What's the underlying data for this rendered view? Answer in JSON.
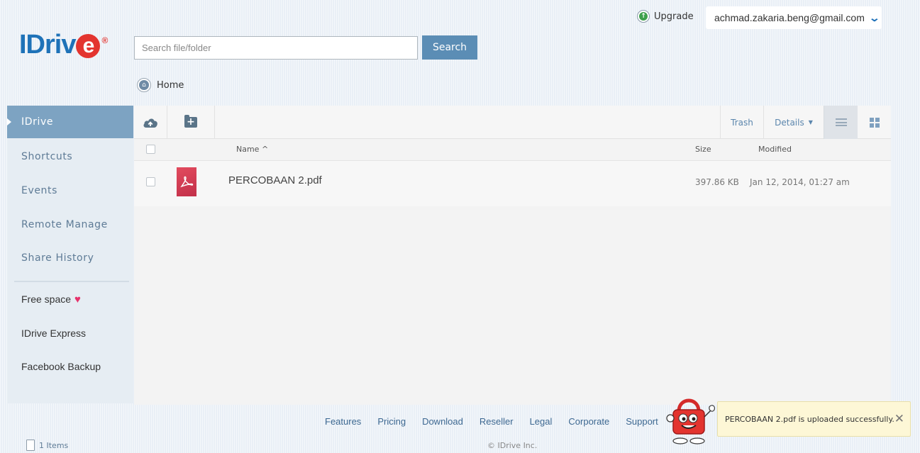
{
  "header": {
    "upgrade_label": "Upgrade",
    "account_email": "achmad.zakaria.beng@gmail.com"
  },
  "logo": {
    "text": "IDriv",
    "e_letter": "e",
    "reg": "®"
  },
  "search": {
    "placeholder": "Search file/folder",
    "value": "",
    "button_label": "Search"
  },
  "breadcrumb": {
    "home_label": "Home"
  },
  "sidebar": {
    "items": [
      {
        "label": "IDrive",
        "active": true
      },
      {
        "label": "Shortcuts"
      },
      {
        "label": "Events"
      },
      {
        "label": "Remote Manage"
      },
      {
        "label": "Share History"
      }
    ],
    "extra_items": [
      {
        "label": "Free space"
      },
      {
        "label": "IDrive Express"
      },
      {
        "label": "Facebook Backup"
      }
    ]
  },
  "toolbar": {
    "trash_label": "Trash",
    "details_label": "Details",
    "upload_icon": "cloud-upload-icon",
    "new_folder_icon": "folder-plus-icon",
    "list_view_icon": "list-view-icon",
    "grid_view_icon": "grid-view-icon"
  },
  "table": {
    "columns": {
      "name": "Name ^",
      "size": "Size",
      "modified": "Modified"
    },
    "rows": [
      {
        "name": "PERCOBAAN 2.pdf",
        "size": "397.86 KB",
        "modified": "Jan 12, 2014, 01:27 am",
        "icon": "pdf-icon"
      }
    ]
  },
  "footer": {
    "links": [
      "Features",
      "Pricing",
      "Download",
      "Reseller",
      "Legal",
      "Corporate",
      "Support"
    ],
    "copyright": "© IDrive Inc.",
    "items_count": "1 Items"
  },
  "toast": {
    "message": "PERCOBAAN 2.pdf is uploaded successfully."
  },
  "colors": {
    "brand_blue": "#1e72b8",
    "brand_red": "#e3342f",
    "sidebar_active": "#7da3c2",
    "search_button": "#5b8db5"
  }
}
